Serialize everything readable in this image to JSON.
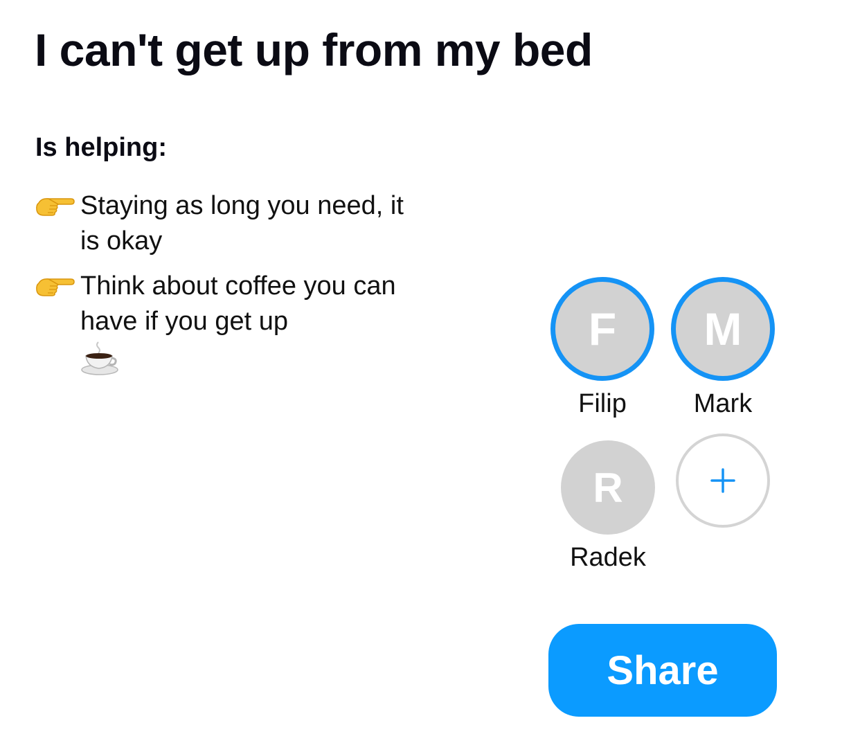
{
  "page": {
    "title": "I can't get up from my bed"
  },
  "helping": {
    "heading": "Is helping:",
    "tips": [
      {
        "icon": "pointing-hand-icon",
        "text": "Staying as long you need, it is okay"
      },
      {
        "icon": "pointing-hand-icon",
        "text": "Think about coffee you can have if you get up",
        "trailing_icon": "coffee-icon"
      }
    ]
  },
  "helpers": [
    {
      "initial": "F",
      "name": "Filip",
      "active": true
    },
    {
      "initial": "M",
      "name": "Mark",
      "active": true
    },
    {
      "initial": "R",
      "name": "Radek",
      "active": false
    }
  ],
  "add_helper": {
    "icon": "plus-icon",
    "label": "+"
  },
  "share": {
    "label": "Share"
  },
  "colors": {
    "accent": "#0b9bff",
    "ring": "#1593f5",
    "avatar_bg": "#d2d2d2",
    "title": "#0b0b14"
  }
}
